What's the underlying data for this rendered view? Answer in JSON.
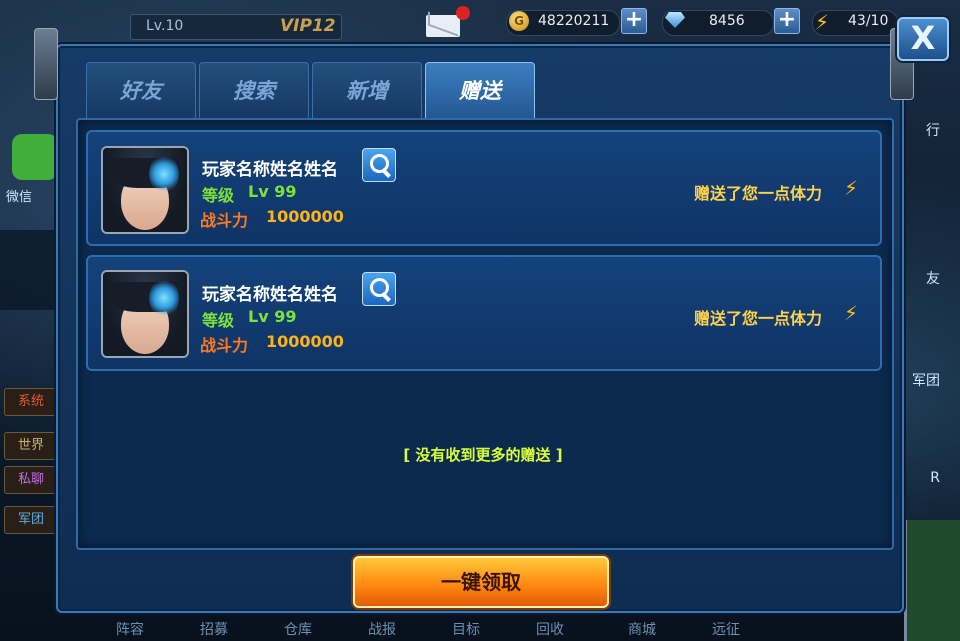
{
  "hud": {
    "level": "Lv.10",
    "vip": "VIP12",
    "gold": "48220211",
    "gems": "8456",
    "stamina": "43/10",
    "add_symbol": "+",
    "close_symbol": "X"
  },
  "background": {
    "wechat_label": "微信",
    "chat_channels": [
      "系统",
      "世界",
      "私聊",
      "军团"
    ],
    "right_labels": [
      "行",
      "友",
      "军团",
      "R"
    ],
    "bottom_labels": [
      "阵容",
      "招募",
      "仓库",
      "战报",
      "目标",
      "回收",
      "商城",
      "远征"
    ]
  },
  "tabs": [
    "好友",
    "搜索",
    "新增",
    "赠送"
  ],
  "active_tab_index": 3,
  "gifts": [
    {
      "player_name": "玩家名称姓名姓名",
      "level_label": "等级",
      "level_value": "Lv 99",
      "power_label": "战斗力",
      "power_value": "1000000",
      "gift_message": "赠送了您一点体力",
      "avatar_icon": "anime-hero-portrait"
    },
    {
      "player_name": "玩家名称姓名姓名",
      "level_label": "等级",
      "level_value": "Lv 99",
      "power_label": "战斗力",
      "power_value": "1000000",
      "gift_message": "赠送了您一点体力",
      "avatar_icon": "anime-hero-portrait"
    }
  ],
  "empty_message": "[ 没有收到更多的赠送 ]",
  "claim_all_label": "一键领取",
  "colors": {
    "accent_blue": "#3a78b6",
    "level_green": "#7ee23a",
    "power_orange": "#ff7a1e",
    "gift_yellow": "#ffd24a",
    "claim_button": "#ff8a12"
  }
}
